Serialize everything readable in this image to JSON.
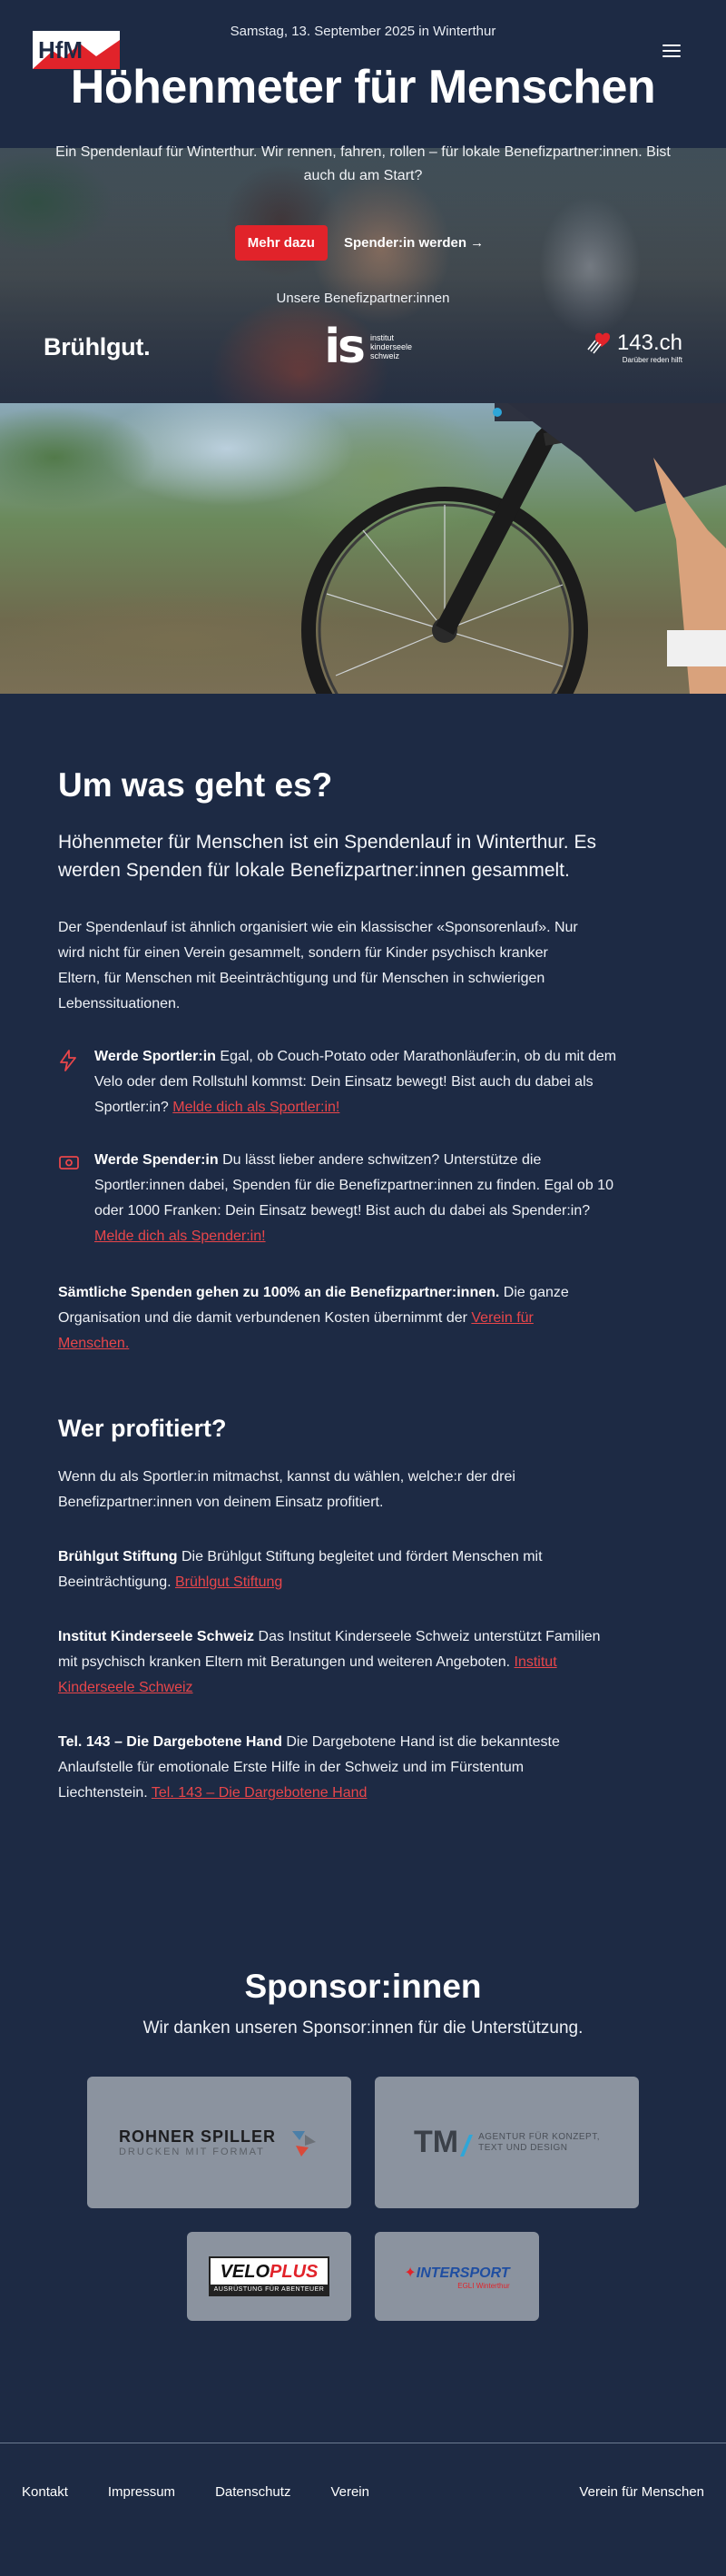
{
  "header": {
    "date": "Samstag, 13. September 2025 in Winterthur",
    "title": "Höhenmeter für Menschen",
    "intro": "Ein Spendenlauf für Winterthur. Wir rennen, fahren, rollen – für lokale Benefizpartner:innen. Bist auch du am Start?",
    "btn_more": "Mehr dazu",
    "btn_donor": "Spender:in werden →",
    "partners_label": "Unsere Benefizpartner:innen",
    "partner_bruehlgut": "Brühlgut.",
    "partner_is_big": "is",
    "partner_is_line1": "institut",
    "partner_is_line2": "kinderseele",
    "partner_is_line3": "schweiz",
    "partner_143_num": "143.ch",
    "partner_143_tag": "Darüber reden hilft"
  },
  "about": {
    "title": "Um was geht es?",
    "lead": "Höhenmeter für Menschen ist ein Spendenlauf in Winterthur. Es werden Spenden für lokale Benefizpartner:innen gesammelt.",
    "para": "Der Spendenlauf ist ähnlich organisiert wie ein klassischer «Sponsorenlauf». Nur wird nicht für einen Verein gesammelt, sondern für Kinder psychisch kranker Eltern, für Menschen mit Beeinträchtigung und für Menschen in schwierigen Lebenssituationen.",
    "athlete_strong": "Werde Sportler:in",
    "athlete_text": " Egal, ob Couch-Potato oder Marathonläufer:in, ob du mit dem Velo oder dem Rollstuhl kommst: Dein Einsatz bewegt! Bist auch du dabei als Sportler:in? ",
    "athlete_link": "Melde dich als Sportler:in!",
    "donor_strong": "Werde Spender:in",
    "donor_text": " Du lässt lieber andere schwitzen? Unterstütze die Sportler:innen dabei, Spenden für die Benefizpartner:innen zu finden. Egal ob 10 oder 1000 Franken: Dein Einsatz bewegt! Bist auch du dabei als Spender:in? ",
    "donor_link": "Melde dich als Spender:in!",
    "all_strong": "Sämtliche Spenden gehen zu 100% an die Benefizpartner:innen.",
    "all_text": " Die ganze Organisation und die damit verbundenen Kosten übernimmt der ",
    "all_link": "Verein für Menschen."
  },
  "profit": {
    "title": "Wer profitiert?",
    "intro": "Wenn du als Sportler:in mitmachst, kannst du wählen, welche:r der drei Benefizpartner:innen von deinem Einsatz profitiert.",
    "items": [
      {
        "name": "Brühlgut Stiftung",
        "text": " Die Brühlgut Stiftung begleitet und fördert Menschen mit Beeinträchtigung. ",
        "link": "Brühlgut Stiftung"
      },
      {
        "name": "Institut Kinderseele Schweiz",
        "text": " Das Institut Kinderseele Schweiz unterstützt Familien mit psychisch kranken Eltern mit Beratungen und weiteren Angeboten. ",
        "link": "Institut Kinderseele Schweiz"
      },
      {
        "name": "Tel. 143 – Die Dargebotene Hand",
        "text": " Die Dargebotene Hand ist die bekannteste Anlaufstelle für emotionale Erste Hilfe in der Schweiz und im Fürstentum Liechtenstein. ",
        "link": "Tel. 143 – Die Dargebotene Hand"
      }
    ]
  },
  "sponsors": {
    "title": "Sponsor:innen",
    "subtitle": "Wir danken unseren Sponsor:innen für die Unterstützung.",
    "rohner_name": "ROHNER SPILLER",
    "rohner_sub": "DRUCKEN MIT FORMAT",
    "tm_mark": "TM",
    "tm_line1": "AGENTUR FÜR KONZEPT,",
    "tm_line2": "TEXT UND DESIGN",
    "velo_a": "VELO",
    "velo_b": "PLUS",
    "velo_tag": "AUSRÜSTUNG FÜR ABENTEUER",
    "inter_name": "INTERSPORT",
    "inter_sub": "EGLI Winterthur"
  },
  "footer": {
    "links": [
      "Kontakt",
      "Impressum",
      "Datenschutz",
      "Verein"
    ],
    "right": "Verein für Menschen"
  },
  "colors": {
    "background": "#1d2a44",
    "accent_red": "#e1232a",
    "link_red": "#e8464a",
    "sponsor_card": "#8b939f"
  },
  "icons": {
    "menu": "hamburger-icon",
    "athlete": "lightning-icon",
    "donor": "banknote-icon"
  }
}
